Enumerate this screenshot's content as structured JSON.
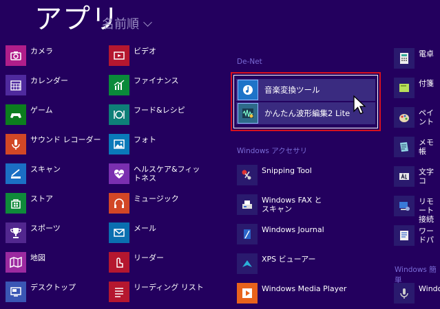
{
  "header": {
    "title": "アプリ",
    "sort_label": "名前順"
  },
  "colors": {
    "background": "#23005e",
    "group_label": "#7a6bd6",
    "selection": "#d8101e"
  },
  "col1": [
    {
      "label": "カメラ",
      "icon": "camera-icon",
      "color": "#b01e8a"
    },
    {
      "label": "カレンダー",
      "icon": "calendar-icon",
      "color": "#4f2a9e"
    },
    {
      "label": "ゲーム",
      "icon": "gamepad-icon",
      "color": "#0c7d1e"
    },
    {
      "label": "サウンド レコーダー",
      "icon": "microphone-icon",
      "color": "#d24726"
    },
    {
      "label": "スキャン",
      "icon": "scanner-icon",
      "color": "#1b6fc4"
    },
    {
      "label": "ストア",
      "icon": "store-icon",
      "color": "#0f8a3a"
    },
    {
      "label": "スポーツ",
      "icon": "trophy-icon",
      "color": "#52278f"
    },
    {
      "label": "地図",
      "icon": "map-icon",
      "color": "#9c2aa0"
    },
    {
      "label": "デスクトップ",
      "icon": "desktop-icon",
      "color": "#3a56b4"
    }
  ],
  "col2": [
    {
      "label": "ビデオ",
      "icon": "video-icon",
      "color": "#b5172f"
    },
    {
      "label": "ファイナンス",
      "icon": "finance-icon",
      "color": "#0a8a3a"
    },
    {
      "label": "フード&レシピ",
      "icon": "food-icon",
      "color": "#0e7f78"
    },
    {
      "label": "フォト",
      "icon": "photo-icon",
      "color": "#0a79b9"
    },
    {
      "label": "ヘルスケア&フィットネス",
      "icon": "heart-icon",
      "color": "#7a2fb0"
    },
    {
      "label": "ミュージック",
      "icon": "headphones-icon",
      "color": "#d24726"
    },
    {
      "label": "メール",
      "icon": "mail-icon",
      "color": "#0a6fb0"
    },
    {
      "label": "リーダー",
      "icon": "reader-icon",
      "color": "#b5172f"
    },
    {
      "label": "リーディング リスト",
      "icon": "reading-list-icon",
      "color": "#b5172f"
    }
  ],
  "col3_groups": {
    "denet": "De-Net",
    "accessories": "Windows アクセサリ"
  },
  "denet_items": [
    {
      "label": "音楽変換ツール",
      "icon": "music-convert-icon"
    },
    {
      "label": "かんたん波形編集2 Lite",
      "icon": "waveform-icon"
    }
  ],
  "col3": [
    {
      "label": "Snipping Tool",
      "icon": "scissors-icon"
    },
    {
      "label": "Windows FAX とスキャン",
      "icon": "fax-icon"
    },
    {
      "label": "Windows Journal",
      "icon": "journal-icon"
    },
    {
      "label": "XPS ビューアー",
      "icon": "xps-icon"
    },
    {
      "label": "Windows Media Player",
      "icon": "media-player-icon"
    }
  ],
  "col4": [
    {
      "label": "電卓",
      "icon": "calculator-icon"
    },
    {
      "label": "付箋",
      "icon": "sticky-note-icon"
    },
    {
      "label": "ペイント",
      "icon": "paint-icon"
    },
    {
      "label": "メモ帳",
      "icon": "notepad-icon"
    },
    {
      "label": "文字コ",
      "icon": "charmap-icon"
    },
    {
      "label": "リモート 接続",
      "icon": "remote-icon"
    },
    {
      "label": "ワードパ",
      "icon": "wordpad-icon"
    },
    {
      "label": "Windo",
      "icon": "microphone-icon"
    }
  ],
  "col4_group": "Windows 簡単"
}
